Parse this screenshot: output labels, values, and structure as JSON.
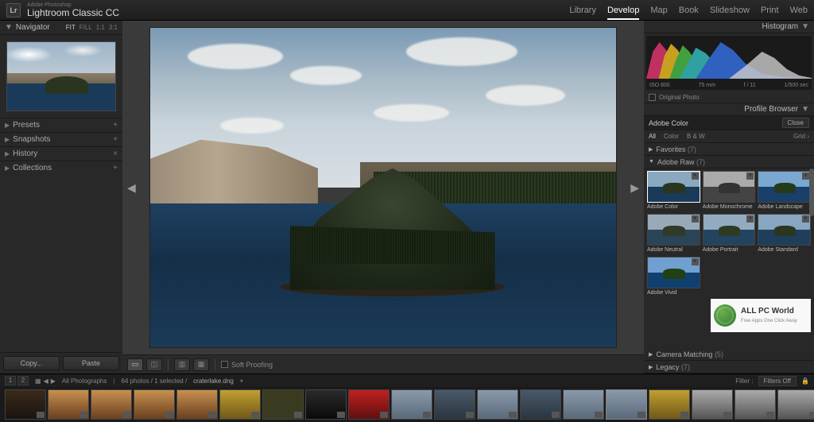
{
  "app": {
    "brand_top": "Adobe Photoshop",
    "title": "Lightroom Classic CC"
  },
  "modules": [
    "Library",
    "Develop",
    "Map",
    "Book",
    "Slideshow",
    "Print",
    "Web"
  ],
  "active_module": "Develop",
  "navigator": {
    "title": "Navigator",
    "zooms": [
      "FIT",
      "FILL",
      "1:1",
      "3:1"
    ],
    "zoom_sel": "FIT"
  },
  "left_sections": [
    "Presets",
    "Snapshots",
    "History",
    "Collections"
  ],
  "left_buttons": {
    "copy": "Copy...",
    "paste": "Paste"
  },
  "toolbar": {
    "soft_proofing": "Soft Proofing"
  },
  "histogram": {
    "title": "Histogram",
    "iso": "ISO 800",
    "focal": "75 mm",
    "aperture": "f / 11",
    "shutter": "1/500 sec",
    "original": "Original Photo"
  },
  "profile": {
    "browser": "Profile Browser",
    "current": "Adobe Color",
    "close": "Close",
    "filters": [
      "All",
      "Color",
      "B & W"
    ],
    "filter_sel": "All",
    "grid_link": "Grid ›",
    "favorites": {
      "label": "Favorites",
      "count": "(7)"
    },
    "adobe_raw": {
      "label": "Adobe Raw",
      "count": "(7)"
    },
    "items": [
      "Adobe Color",
      "Adobe Monochrome",
      "Adobe Landscape",
      "Adobe Neutral",
      "Adobe Portrait",
      "Adobe Standard",
      "Adobe Vivid"
    ],
    "camera_matching": {
      "label": "Camera Matching",
      "count": "(5)"
    },
    "legacy": {
      "label": "Legacy",
      "count": "(7)"
    }
  },
  "watermark": {
    "title": "ALL PC World",
    "sub": "Free Apps One Click Away"
  },
  "filmstrip": {
    "nav": [
      "1",
      "2"
    ],
    "source": "All Photographs",
    "count": "64 photos / 1 selected /",
    "filename": "craterlake.dng",
    "filter_label": "Filter :",
    "filter_value": "Filters Off"
  }
}
